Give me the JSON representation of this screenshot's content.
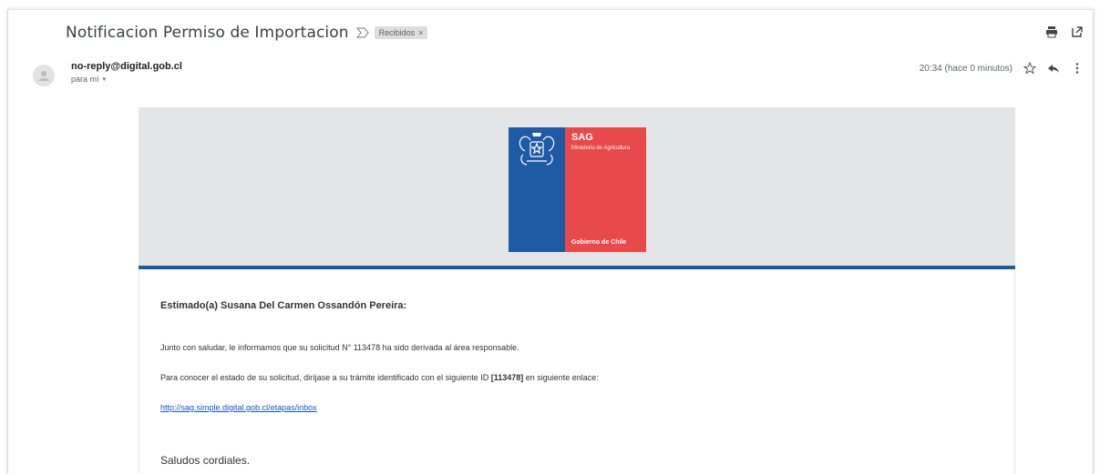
{
  "email": {
    "subject": "Notificacion Permiso de Importacion",
    "label": "Recibidos",
    "label_close": "×",
    "sender": "no-reply@digital.gob.cl",
    "to_line": "para mí",
    "to_caret": "▾",
    "timestamp": "20:34 (hace 0 minutos)"
  },
  "logo": {
    "title": "SAG",
    "ministry": "Ministerio de Agricultura",
    "government": "Gobierno de Chile",
    "blue": "#1f5aa5",
    "red": "#e8494a"
  },
  "body": {
    "greeting": "Estimado(a) Susana Del Carmen Ossandón Pereira:",
    "paragraph1": "Junto con saludar, le informamos que su solicitud N° 113478 ha sido derivada al área responsable.",
    "paragraph2_prefix": "Para conocer el estado de su solicitud, diríjase a su trámite identificado con el siguiente ID ",
    "paragraph2_id": "[113478]",
    "paragraph2_suffix": " en siguiente enlace:",
    "link": "http://sag.simple.digital.gob.cl/etapas/inbox",
    "closing": "Saludos cordiales."
  },
  "icons": {
    "top_actions": [
      "print-icon",
      "open-new-window-icon"
    ],
    "meta_actions": [
      "star-icon",
      "reply-icon",
      "more-vert-icon"
    ]
  },
  "colors": {
    "header_band": "#e4e5e7",
    "rule": "#1f5b96",
    "link": "#1155cc"
  }
}
